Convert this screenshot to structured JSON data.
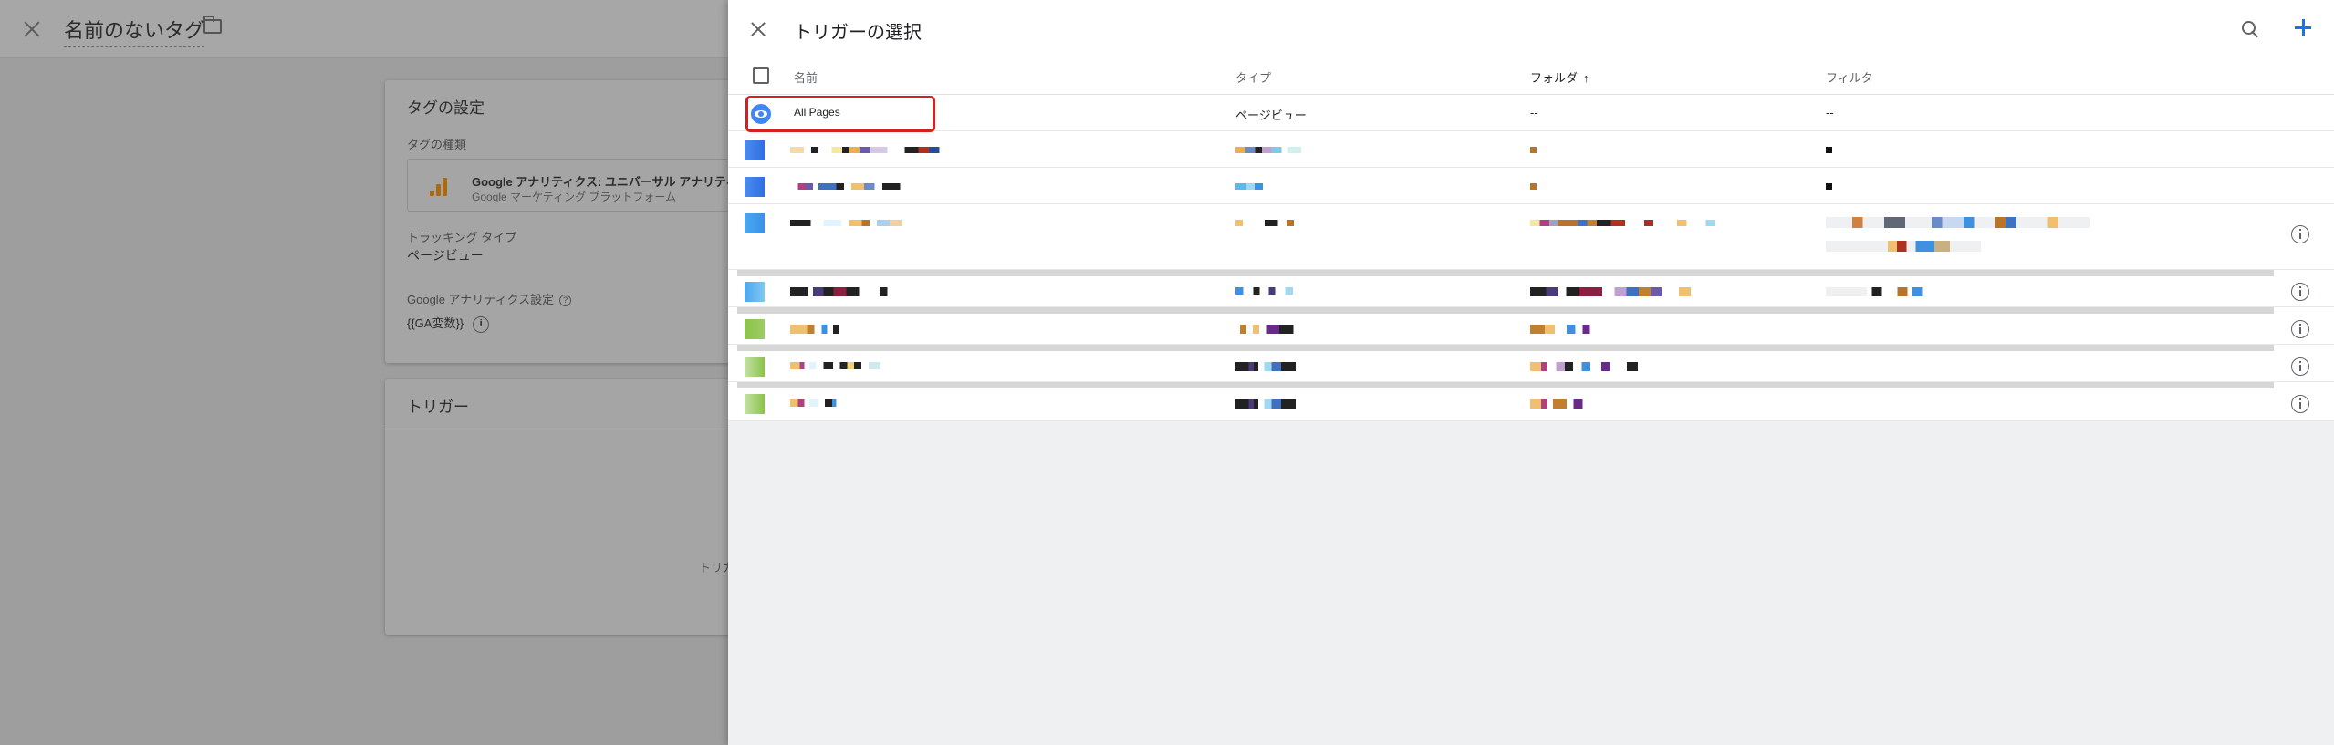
{
  "background_editor": {
    "title": "名前のないタグ",
    "tag_config": {
      "heading": "タグの設定",
      "type_label": "タグの種類",
      "type_name": "Google アナリティクス: ユニバーサル アナリティクス",
      "type_vendor": "Google マーケティング プラットフォーム",
      "tracking_type_label": "トラッキング タイプ",
      "tracking_type_value": "ページビュー",
      "ga_settings_label": "Google アナリティクス設定",
      "ga_settings_value": "{{GA変数}}"
    },
    "trigger_card": {
      "heading": "トリガー",
      "hint": "トリガ"
    }
  },
  "panel": {
    "title": "トリガーの選択",
    "columns": {
      "name": "名前",
      "type": "タイプ",
      "folder": "フォルダ",
      "filter": "フィルタ"
    },
    "sort_indicator": "↑",
    "rows": [
      {
        "name": "All Pages",
        "type": "ページビュー",
        "folder": "--",
        "filter": "--"
      }
    ]
  },
  "colors": {
    "accent": "#1a73e8",
    "highlight": "#d32020",
    "eye_icon": "#4285f4"
  }
}
